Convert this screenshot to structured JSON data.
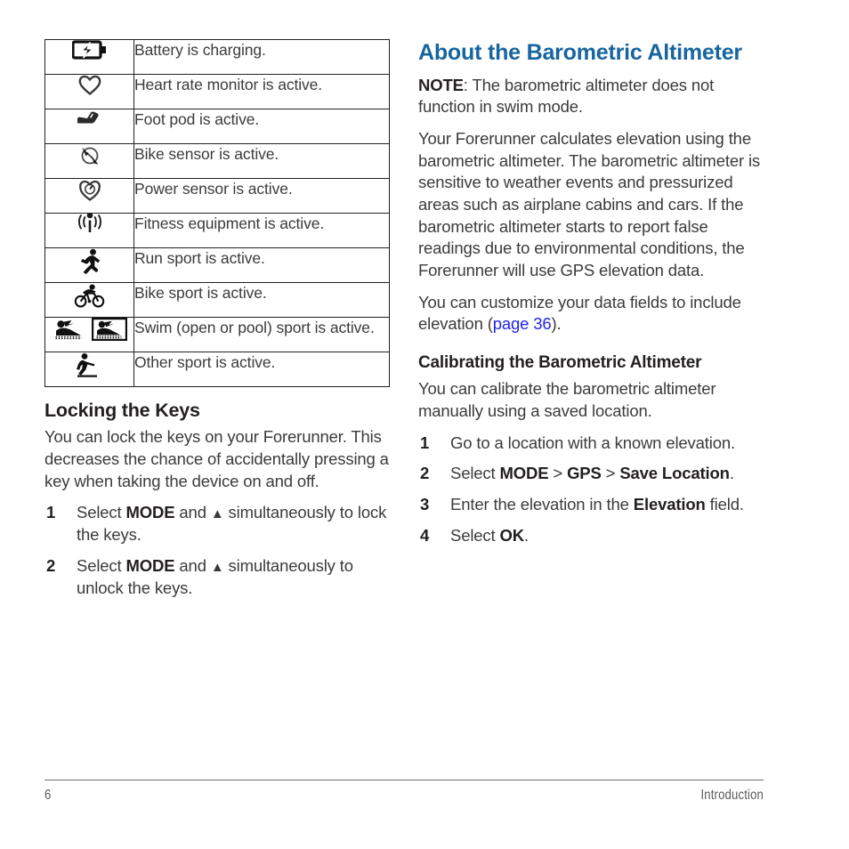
{
  "page": {
    "number": "6",
    "footer_title": "Introduction"
  },
  "colors": {
    "heading_blue": "#17659f",
    "link_blue": "#2322ef",
    "body_text": "#3b3b3d",
    "rule": "#6d6e70"
  },
  "status_table": {
    "rows": [
      {
        "icon": "battery-charging-icon",
        "description": "Battery is charging."
      },
      {
        "icon": "heart-rate-monitor-icon",
        "description": "Heart rate monitor is active."
      },
      {
        "icon": "foot-pod-icon",
        "description": "Foot pod is active."
      },
      {
        "icon": "bike-sensor-icon",
        "description": "Bike sensor is active."
      },
      {
        "icon": "power-sensor-icon",
        "description": "Power sensor is active."
      },
      {
        "icon": "fitness-equipment-icon",
        "description": "Fitness equipment is active."
      },
      {
        "icon": "run-sport-icon",
        "description": "Run sport is active."
      },
      {
        "icon": "bike-sport-icon",
        "description": "Bike sport is active."
      },
      {
        "icon": "swim-open-and-pool-sport-icon",
        "description": "Swim (open or pool) sport is active."
      },
      {
        "icon": "other-sport-icon",
        "description": "Other sport is active."
      }
    ]
  },
  "locking_keys": {
    "heading": "Locking the Keys",
    "intro": "You can lock the keys on your Forerunner. This decreases the chance of accidentally pressing a key when taking the device on and off.",
    "steps": [
      {
        "number": "1",
        "prefix": "Select ",
        "key1": "MODE",
        "middle": " and ",
        "triangle": "▲",
        "suffix": " simultaneously to lock the keys."
      },
      {
        "number": "2",
        "prefix": "Select ",
        "key1": "MODE",
        "middle": " and ",
        "triangle": "▲",
        "suffix": " simultaneously to unlock the keys."
      }
    ]
  },
  "about_altimeter": {
    "heading": "About the Barometric Altimeter",
    "note_label": "NOTE",
    "note_text": ": The barometric altimeter does not function in swim mode.",
    "paragraph": "Your Forerunner calculates elevation using the barometric altimeter. The barometric altimeter is sensitive to weather events and pressurized areas such as airplane cabins and cars. If the barometric altimeter starts to report false readings due to environmental conditions, the Forerunner will use GPS elevation data.",
    "customize_prefix": "You can customize your data fields to include elevation (",
    "customize_link": "page 36",
    "customize_suffix": ")."
  },
  "calibrating": {
    "heading": "Calibrating the Barometric Altimeter",
    "intro": "You can calibrate the barometric altimeter manually using a saved location.",
    "steps": [
      {
        "number": "1",
        "parts": [
          {
            "text": "Go to a location with a known elevation.",
            "bold": false
          }
        ]
      },
      {
        "number": "2",
        "parts": [
          {
            "text": "Select ",
            "bold": false
          },
          {
            "text": "MODE",
            "bold": true
          },
          {
            "text": " > ",
            "bold": false
          },
          {
            "text": "GPS",
            "bold": true
          },
          {
            "text": " > ",
            "bold": false
          },
          {
            "text": "Save Location",
            "bold": true
          },
          {
            "text": ".",
            "bold": false
          }
        ]
      },
      {
        "number": "3",
        "parts": [
          {
            "text": "Enter the elevation in the ",
            "bold": false
          },
          {
            "text": "Elevation",
            "bold": true
          },
          {
            "text": " field.",
            "bold": false
          }
        ]
      },
      {
        "number": "4",
        "parts": [
          {
            "text": "Select ",
            "bold": false
          },
          {
            "text": "OK",
            "bold": true
          },
          {
            "text": ".",
            "bold": false
          }
        ]
      }
    ]
  }
}
